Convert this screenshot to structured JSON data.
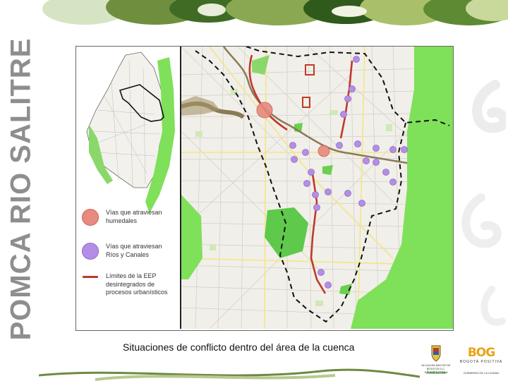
{
  "slide": {
    "vertical_title": "POMCA RIO SALITRE",
    "caption": "Situaciones de conflicto dentro del área de la cuenca"
  },
  "legend": {
    "items": [
      {
        "label": "Vías que atraviesan humedales",
        "symbol": "pink-circle",
        "color": "#e88a7e"
      },
      {
        "label": "Vías que atraviesan Ríos y Canales",
        "symbol": "purple-circle",
        "color": "#b48ee6"
      },
      {
        "label": "Límites de la EEP desintegrados de procesos urbanísticos",
        "symbol": "red-line",
        "color": "#c0392b"
      }
    ]
  },
  "logos": {
    "alcaldia_text": "ALCALDÍA MAYOR DE BOGOTÁ D.C. Secretaría Distrital",
    "ambiente": "Ambiente",
    "bog": "BOG",
    "bog_sub": "BOGOTÁ POSITIVA",
    "bog_gov": "GOBIERNO DE LA CIUDAD"
  },
  "colors": {
    "title_gray": "#8e8e8e",
    "park_green": "#7fe05a",
    "wetland_pink": "#e88a7e",
    "crossing_purple": "#b48ee6",
    "eep_red": "#c0392b",
    "boundary_black": "#111111"
  }
}
